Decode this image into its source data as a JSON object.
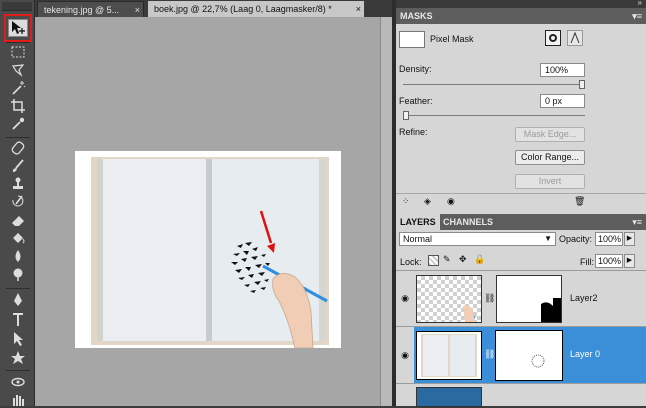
{
  "tabs": [
    {
      "label": "tekening.jpg @ 5...",
      "close": "×"
    },
    {
      "label": "boek.jpg @ 22,7% (Laag 0, Laagmasker/8) *",
      "close": "×"
    }
  ],
  "masks_panel": {
    "title": "MASKS",
    "mask_type": "Pixel Mask",
    "density_label": "Density:",
    "density_value": "100%",
    "density_level": 1.0,
    "feather_label": "Feather:",
    "feather_value": "0 px",
    "feather_level": 0.0,
    "refine_label": "Refine:",
    "mask_edge_button": "Mask Edge...",
    "color_range_button": "Color Range...",
    "invert_button": "Invert"
  },
  "layers_panel": {
    "tab_layers": "LAYERS",
    "tab_channels": "CHANNELS",
    "blend_mode": "Normal",
    "opacity_label": "Opacity:",
    "opacity_value": "100%",
    "lock_label": "Lock:",
    "fill_label": "Fill:",
    "fill_value": "100%",
    "layers": [
      {
        "name": "Layer2",
        "selected": false
      },
      {
        "name": "Layer 0",
        "selected": true
      }
    ]
  },
  "colors": {
    "selection_blue": "#3b8fd8",
    "highlight_red": "#e21b1b",
    "arrow_red": "#e01010",
    "pencil_blue": "#2f8ee0",
    "bottom_layer_blue": "#2a6aa0"
  },
  "icons": [
    "move-tool-icon",
    "marquee-tool-icon",
    "lasso-tool-icon",
    "magic-wand-icon",
    "crop-tool-icon",
    "eyedropper-icon",
    "healing-brush-icon",
    "brush-tool-icon",
    "clone-stamp-icon",
    "history-brush-icon",
    "eraser-icon",
    "paint-bucket-icon",
    "blur-tool-icon",
    "dodge-tool-icon",
    "pen-tool-icon",
    "type-tool-icon",
    "path-selection-icon",
    "shape-tool-icon",
    "3d-rotate-icon",
    "hand-tool-icon"
  ]
}
